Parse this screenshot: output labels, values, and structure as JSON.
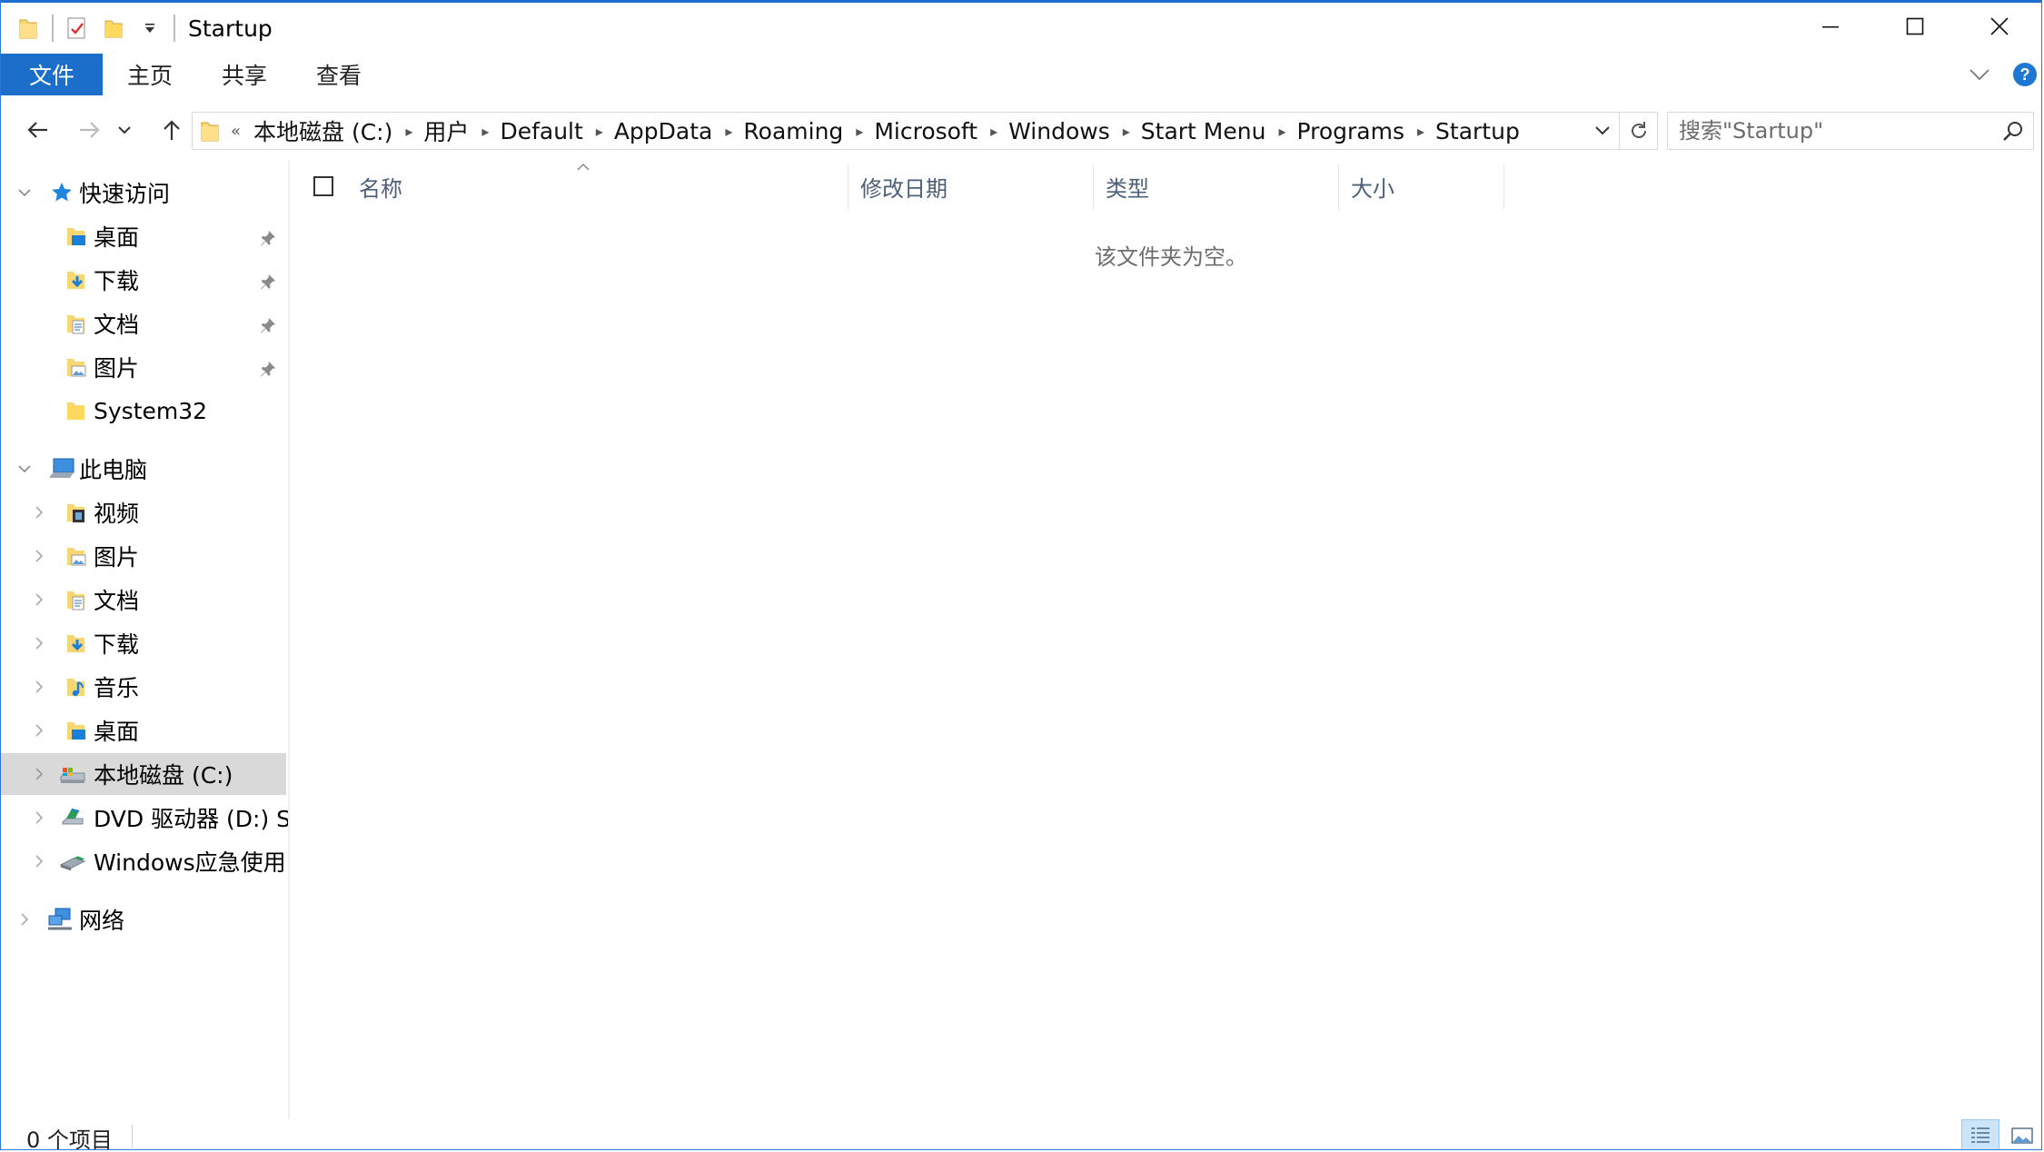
{
  "window": {
    "title": "Startup",
    "accent_color": "#1b6ec9"
  },
  "quick_access_toolbar": {
    "icons": [
      "folder-icon",
      "properties-icon",
      "new-folder-icon",
      "customize-dropdown-icon"
    ]
  },
  "ribbon": {
    "tabs": [
      {
        "label": "文件",
        "active": true
      },
      {
        "label": "主页"
      },
      {
        "label": "共享"
      },
      {
        "label": "查看"
      }
    ]
  },
  "address_bar": {
    "overflow_glyph": "«",
    "crumbs": [
      "本地磁盘 (C:)",
      "用户",
      "Default",
      "AppData",
      "Roaming",
      "Microsoft",
      "Windows",
      "Start Menu",
      "Programs",
      "Startup"
    ]
  },
  "search": {
    "placeholder": "搜索\"Startup\""
  },
  "nav_pane": {
    "quick_access": {
      "label": "快速访问",
      "items": [
        {
          "label": "桌面",
          "icon": "desktop-folder-icon",
          "pinned": true
        },
        {
          "label": "下载",
          "icon": "downloads-folder-icon",
          "pinned": true
        },
        {
          "label": "文档",
          "icon": "documents-folder-icon",
          "pinned": true
        },
        {
          "label": "图片",
          "icon": "pictures-folder-icon",
          "pinned": true
        },
        {
          "label": "System32",
          "icon": "folder-icon",
          "pinned": false
        }
      ]
    },
    "this_pc": {
      "label": "此电脑",
      "items": [
        {
          "label": "视频",
          "icon": "videos-folder-icon"
        },
        {
          "label": "图片",
          "icon": "pictures-folder-icon"
        },
        {
          "label": "文档",
          "icon": "documents-folder-icon"
        },
        {
          "label": "下载",
          "icon": "downloads-folder-icon"
        },
        {
          "label": "音乐",
          "icon": "music-folder-icon"
        },
        {
          "label": "桌面",
          "icon": "desktop-folder-icon"
        },
        {
          "label": "本地磁盘 (C:)",
          "icon": "local-disk-icon",
          "selected": true
        },
        {
          "label": "DVD 驱动器 (D:) SS",
          "icon": "dvd-drive-icon"
        },
        {
          "label": "Windows应急使用 (",
          "icon": "usb-drive-icon"
        }
      ]
    },
    "network": {
      "label": "网络"
    }
  },
  "file_list": {
    "columns": [
      "名称",
      "修改日期",
      "类型",
      "大小"
    ],
    "sorted_column": "名称",
    "empty_message": "该文件夹为空。"
  },
  "status_bar": {
    "item_count": "0 个项目",
    "view_mode": "details"
  }
}
